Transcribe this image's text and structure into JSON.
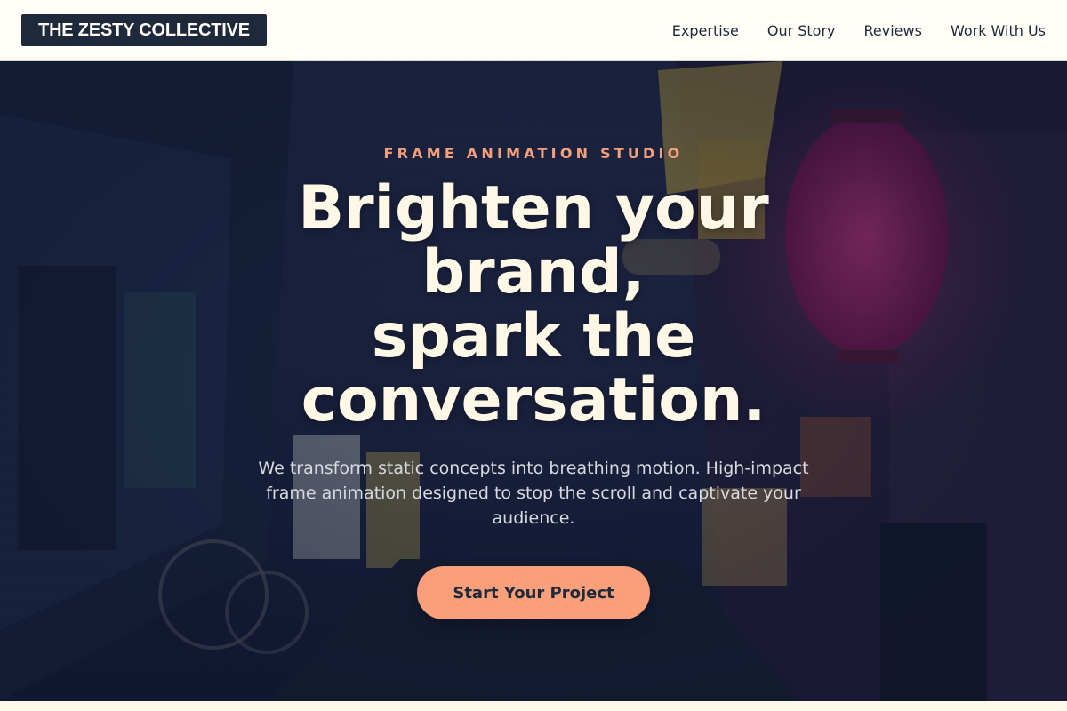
{
  "header": {
    "logo_text": "THE ZESTY COLLECTIVE",
    "nav": [
      "Expertise",
      "Our Story",
      "Reviews",
      "Work With Us"
    ]
  },
  "hero": {
    "eyebrow": "FRAME ANIMATION STUDIO",
    "headline_line1": "Brighten your brand,",
    "headline_line2": "spark the conversation.",
    "subtext": "We transform static concepts into breathing motion. High-impact frame animation designed to stop the scroll and captivate your audience.",
    "cta_label": "Start Your Project",
    "background_image": "neon-alley-night-photo"
  },
  "colors": {
    "logo_bg": "#1e293b",
    "accent": "#f99f7a",
    "eyebrow": "#f4a07c",
    "headline": "#fff8e6",
    "page_bg": "#fffcf2"
  }
}
